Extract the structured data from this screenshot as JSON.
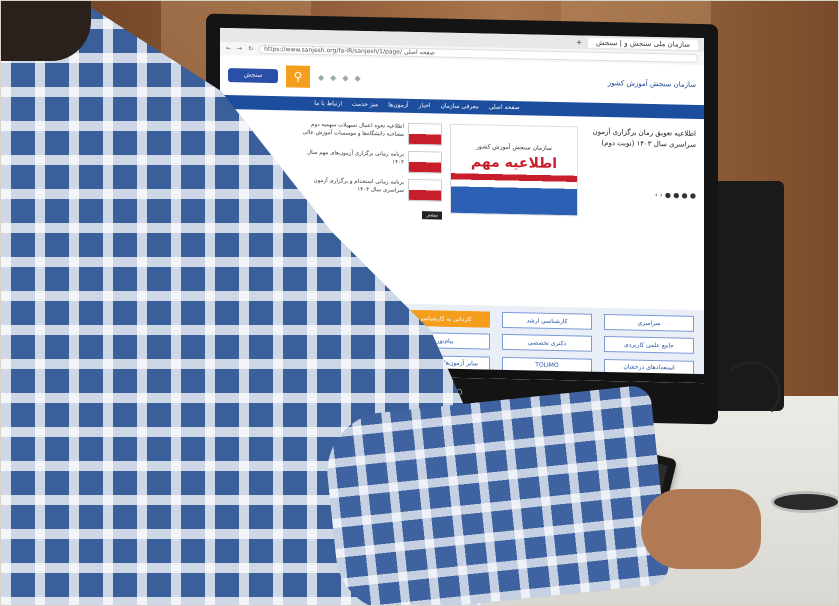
{
  "browser": {
    "tab_title": "سازمان ملی سنجش و | سنجش",
    "url": "https://www.sanjesh.org/fa-IR/sanjesh/1/page/ صفحه اصلی"
  },
  "site": {
    "org_name": "سازمان سنجش آموزش کشور",
    "logo_text": "سنجش"
  },
  "nav": [
    "صفحه اصلی",
    "معرفی سازمان",
    "اخبار",
    "آزمون‌ها",
    "میز خدمت",
    "ارتباط با ما"
  ],
  "hero": {
    "headline": "اطلاعیه تعویق زمان برگزاری آزمون سراسری سال ۱۴۰۳ (نوبت دوم)",
    "banner_org": "سازمان سنجش آموزش کشور",
    "banner_title": "اطلاعیه مهم",
    "more_label": "بیشتر"
  },
  "news": [
    {
      "thumb": "اطلاعیه",
      "text": "اطلاعیه نحوه اعمال تسهیلات سهمیه دوم مصاحبه دانشگاه‌ها و موسسات آموزش عالی"
    },
    {
      "thumb": "اطلاعیه مهم",
      "text": "برنامه زمانی برگزاری آزمون‌های مهم سال ۱۴۰۳"
    },
    {
      "thumb": "اطلاعیه",
      "text": "برنامه زمانی استخدام و برگزاری آزمون سراسری سال ۱۴۰۳"
    }
  ],
  "quick_links": [
    {
      "label": "سراسری",
      "active": false
    },
    {
      "label": "کارشناسی ارشد",
      "active": false
    },
    {
      "label": "کاردانی به کارشناسی",
      "active": true
    },
    {
      "label": "",
      "active": false
    },
    {
      "label": "جامع علمی کاربردی",
      "active": false
    },
    {
      "label": "دکتری تخصصی",
      "active": false
    },
    {
      "label": "پیام‌نور",
      "active": false
    },
    {
      "label": "",
      "active": false
    },
    {
      "label": "استعدادهای درخشان",
      "active": false
    },
    {
      "label": "TOLIMO",
      "active": false
    },
    {
      "label": "سایر آزمون‌های استخدامی",
      "active": false
    }
  ],
  "monitor_brand": "lenovo"
}
